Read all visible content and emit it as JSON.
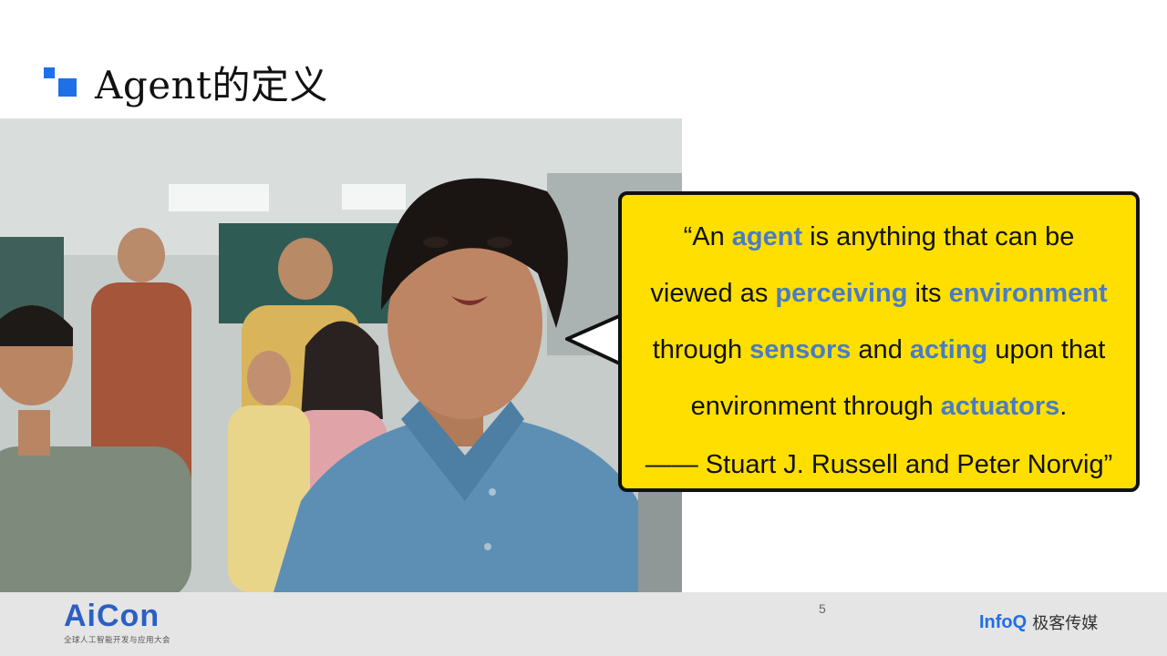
{
  "slide": {
    "title": "Agent的定义",
    "page_number": "5"
  },
  "quote": {
    "lines": [
      [
        {
          "t": "“An ",
          "hl": false
        },
        {
          "t": "agent",
          "hl": true
        },
        {
          "t": " is anything that can be",
          "hl": false
        }
      ],
      [
        {
          "t": "viewed as ",
          "hl": false
        },
        {
          "t": "perceiving",
          "hl": true
        },
        {
          "t": " its ",
          "hl": false
        },
        {
          "t": "environment",
          "hl": true
        }
      ],
      [
        {
          "t": "through ",
          "hl": false
        },
        {
          "t": "sensors",
          "hl": true
        },
        {
          "t": " and ",
          "hl": false
        },
        {
          "t": "acting",
          "hl": true
        },
        {
          "t": " upon that",
          "hl": false
        }
      ],
      [
        {
          "t": "environment through ",
          "hl": false
        },
        {
          "t": "actuators",
          "hl": true
        },
        {
          "t": ".",
          "hl": false
        }
      ],
      [
        {
          "t": "—— Stuart J. Russell and Peter Norvig”",
          "hl": false
        }
      ]
    ],
    "highlight_color": "#4a7cc4",
    "bubble_color": "#ffdf00"
  },
  "footer": {
    "aicon_logo": "AiCon",
    "aicon_subtitle": "全球人工智能开发与应用大会",
    "infoq_logo": "InfoQ",
    "infoq_cn": "极客传媒"
  },
  "colors": {
    "accent": "#1f6fe6",
    "footer_bg": "#e5e5e5"
  }
}
